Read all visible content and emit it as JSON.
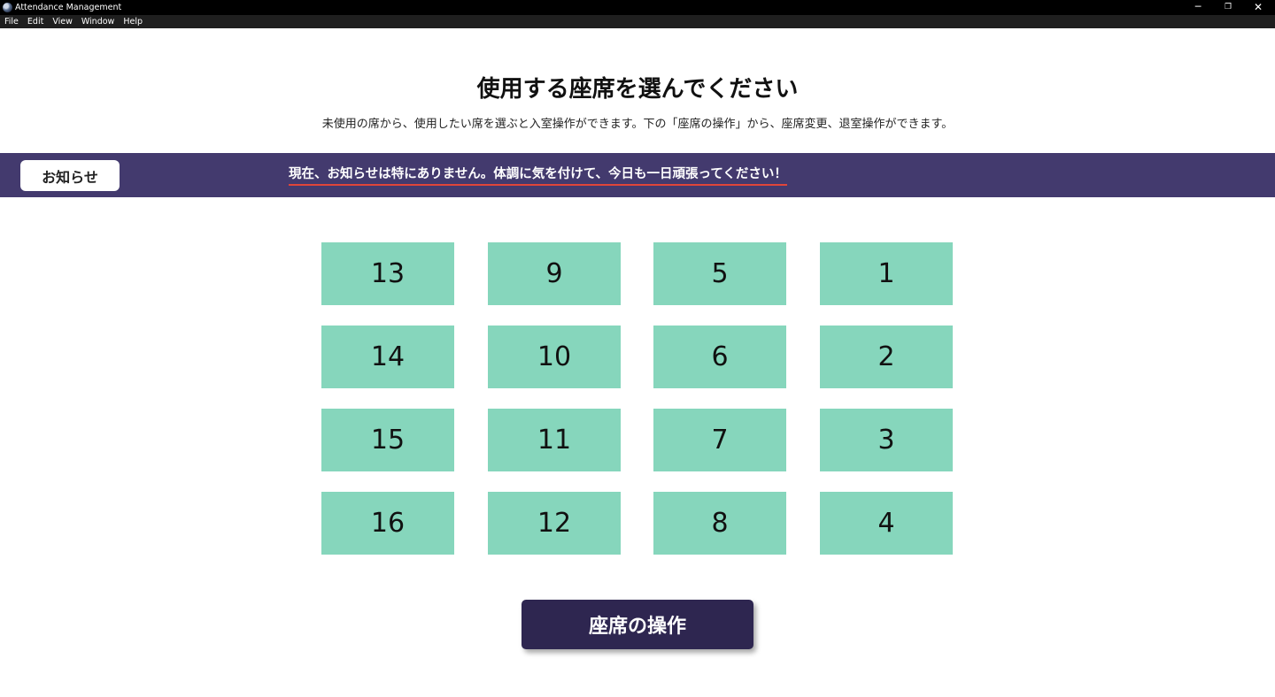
{
  "window": {
    "title": "Attendance Management",
    "controls": {
      "minimize": "─",
      "maximize": "❐",
      "close": "✕"
    }
  },
  "menu": [
    "File",
    "Edit",
    "View",
    "Window",
    "Help"
  ],
  "header": {
    "title": "使用する座席を選んでください",
    "subtitle": "未使用の席から、使用したい席を選ぶと入室操作ができます。下の「座席の操作」から、座席変更、退室操作ができます。"
  },
  "notice": {
    "button_label": "お知らせ",
    "message": "現在、お知らせは特にありません。体調に気を付けて、今日も一日頑張ってください！"
  },
  "seats": [
    [
      "13",
      "9",
      "5",
      "1"
    ],
    [
      "14",
      "10",
      "6",
      "2"
    ],
    [
      "15",
      "11",
      "7",
      "3"
    ],
    [
      "16",
      "12",
      "8",
      "4"
    ]
  ],
  "actions": {
    "seat_operation_label": "座席の操作"
  },
  "colors": {
    "notice_band": "#433a6e",
    "seat_available": "#86d6bc",
    "primary_button": "#2e2650",
    "notice_underline": "#e0453a"
  }
}
